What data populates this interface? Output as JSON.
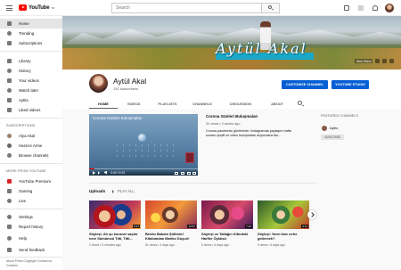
{
  "topbar": {
    "logo_text": "YouTube",
    "logo_region": "TR",
    "search_placeholder": "Search"
  },
  "sidebar": {
    "main": [
      {
        "label": "Home",
        "icon": "home-icon"
      },
      {
        "label": "Trending",
        "icon": "trending-icon"
      },
      {
        "label": "Subscriptions",
        "icon": "subscriptions-icon"
      }
    ],
    "library": [
      {
        "label": "Library",
        "icon": "library-icon"
      },
      {
        "label": "History",
        "icon": "history-icon"
      },
      {
        "label": "Your videos",
        "icon": "your-videos-icon"
      },
      {
        "label": "Watch later",
        "icon": "watch-later-icon"
      },
      {
        "label": "Aytits",
        "icon": "playlist-icon"
      },
      {
        "label": "Liked videos",
        "icon": "liked-icon"
      }
    ],
    "subscriptions_heading": "SUBSCRIPTIONS",
    "subscriptions": [
      {
        "label": "Alya Akal",
        "icon": "channel-avatar-icon"
      },
      {
        "label": "Hazeze Arme",
        "icon": "channel-avatar-icon"
      },
      {
        "label": "Browse channels",
        "icon": "browse-channels-icon"
      }
    ],
    "more_heading": "MORE FROM YOUTUBE",
    "more": [
      {
        "label": "YouTube Premium",
        "icon": "youtube-premium-icon"
      },
      {
        "label": "Gaming",
        "icon": "gaming-icon"
      },
      {
        "label": "Live",
        "icon": "live-icon"
      }
    ],
    "settings": [
      {
        "label": "Settings",
        "icon": "gear-icon"
      },
      {
        "label": "Report history",
        "icon": "flag-icon"
      },
      {
        "label": "Help",
        "icon": "help-icon"
      },
      {
        "label": "Send feedback",
        "icon": "feedback-icon"
      }
    ],
    "footer": "About  Press  Copyright  Contact us  Creators"
  },
  "banner": {
    "title": "Aytül Akal",
    "link_label": "Web Sitesi"
  },
  "channel": {
    "name": "Aytül Akal",
    "subscribers": "151 subscribers",
    "customize_label": "CUSTOMIZE CHANNEL",
    "studio_label": "YOUTUBE STUDIO",
    "tabs": [
      "HOME",
      "VIDEOS",
      "PLAYLISTS",
      "CHANNELS",
      "DISCUSSION",
      "ABOUT"
    ]
  },
  "featured_video": {
    "player_title": "Corona Günleri Buluşmaları",
    "time": "0:40 / 0:23",
    "progress": 0.05,
    "title": "Corona Günleri Buluşmaları",
    "meta": "30 views • 3 weeks ago",
    "description": "Corona pandemisi günlerinde, İnstagramda paylaşım hafta sonları çeşitli ve video buluşmaları duyurulanırdar..."
  },
  "featured_channels": {
    "heading": "FEATURED CHANNELS",
    "name": "Aytits",
    "subscribe_label": "SUBSCRIBE"
  },
  "uploads": {
    "heading": "Uploads",
    "play_all": "PLAY ALL",
    "videos": [
      {
        "title": "Söyleşi: Ah şu korona! saçlar nere Sümümsü Titti, Titti...",
        "meta": "2 views • 5 minutes ago",
        "duration": "0:17"
      },
      {
        "title": "Benim Babam Şöförde! Kitabımdan Mariko Duyuri!",
        "meta": "51 views • 4 days ago",
        "duration": "13:57"
      },
      {
        "title": "Söyleşi ve Tatlağın Kitindeki Harfler Öyküsü",
        "meta": "5 views • 6 days ago",
        "duration": "7:23"
      },
      {
        "title": "Söyleşi: Yarın bize neler getirecek?",
        "meta": "5 views • 6 days ago",
        "duration": "2:11"
      }
    ]
  }
}
